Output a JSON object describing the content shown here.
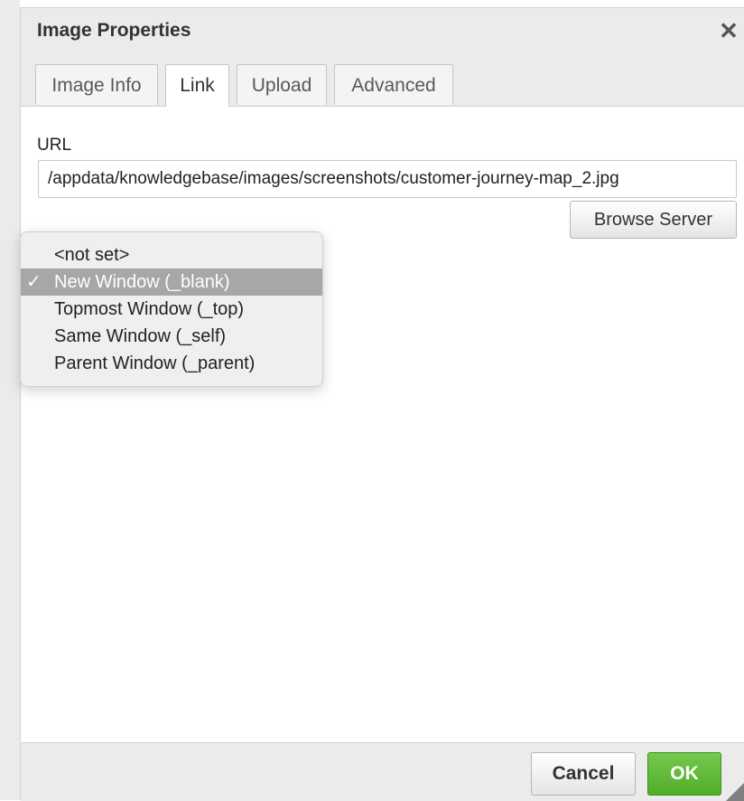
{
  "dialog": {
    "title": "Image Properties",
    "close_icon": "close-icon",
    "close_glyph": "✕"
  },
  "tabs": [
    {
      "label": "Image Info",
      "active": false
    },
    {
      "label": "Link",
      "active": true
    },
    {
      "label": "Upload",
      "active": false
    },
    {
      "label": "Advanced",
      "active": false
    }
  ],
  "link": {
    "url_label": "URL",
    "url_value": "/appdata/knowledgebase/images/screenshots/customer-journey-map_2.jpg",
    "browse_label": "Browse Server"
  },
  "target_dropdown": {
    "selected": "New Window (_blank)",
    "check_glyph": "✓",
    "options": [
      "<not set>",
      "New Window (_blank)",
      "Topmost Window (_top)",
      "Same Window (_self)",
      "Parent Window (_parent)"
    ]
  },
  "footer": {
    "cancel_label": "Cancel",
    "ok_label": "OK"
  },
  "colors": {
    "ok_green": "#5cb531",
    "selected_option": "#a7a7a7",
    "chrome_gray": "#ebebeb"
  }
}
